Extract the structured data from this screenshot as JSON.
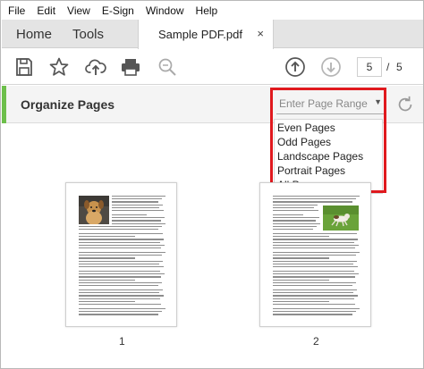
{
  "menu": [
    "File",
    "Edit",
    "View",
    "E-Sign",
    "Window",
    "Help"
  ],
  "tabs": {
    "home": "Home",
    "tools": "Tools",
    "document": "Sample PDF.pdf",
    "close_glyph": "×"
  },
  "toolbar": {
    "icons": [
      "save-icon",
      "bookmark-star-icon",
      "upload-cloud-icon",
      "print-icon",
      "zoom-search-icon",
      "previous-page-icon",
      "next-page-icon"
    ],
    "current_page": "5",
    "separator": "/",
    "total_pages": "5"
  },
  "organize": {
    "title": "Organize Pages",
    "range_placeholder": "Enter Page Range",
    "options": [
      "Even Pages",
      "Odd Pages",
      "Landscape Pages",
      "Portrait Pages",
      "All Pages"
    ],
    "accent_color": "#6dbf4b",
    "highlight_color": "#e0191e"
  },
  "pages": [
    {
      "number": "1",
      "image": "dog-photo"
    },
    {
      "number": "2",
      "image": "dog-running-photo"
    }
  ]
}
